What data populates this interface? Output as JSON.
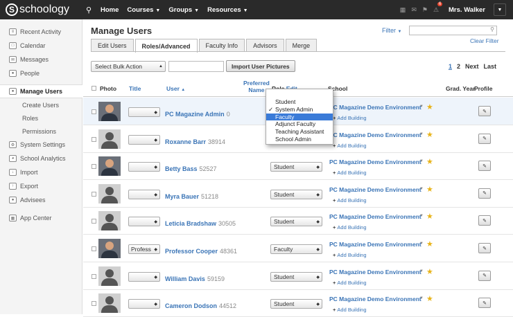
{
  "topbar": {
    "logo_mark": "S",
    "logo_text": "schoology",
    "nav": [
      "Home",
      "Courses",
      "Groups",
      "Resources"
    ],
    "notification_count": "6",
    "user_name": "Mrs. Walker"
  },
  "sidebar": {
    "items": [
      {
        "label": "Recent Activity",
        "icon": "activity-icon"
      },
      {
        "label": "Calendar",
        "icon": "calendar-icon"
      },
      {
        "label": "Messages",
        "icon": "envelope-icon"
      },
      {
        "label": "People",
        "icon": "people-icon"
      },
      {
        "label": "Manage Users",
        "icon": "users-icon"
      }
    ],
    "subitems": [
      "Create Users",
      "Roles",
      "Permissions"
    ],
    "items2": [
      {
        "label": "System Settings",
        "icon": "gear-icon"
      },
      {
        "label": "School Analytics",
        "icon": "analytics-icon"
      },
      {
        "label": "Import",
        "icon": "import-icon"
      },
      {
        "label": "Export",
        "icon": "export-icon"
      },
      {
        "label": "Advisees",
        "icon": "advisees-icon"
      }
    ],
    "app_center": "App Center"
  },
  "main": {
    "title": "Manage Users",
    "filter_label": "Filter",
    "clear_filter": "Clear Filter",
    "tabs": [
      "Edit Users",
      "Roles/Advanced",
      "Faculty Info",
      "Advisors",
      "Merge"
    ],
    "bulk_action": "Select Bulk Action",
    "import_button": "Import User Pictures",
    "pager": {
      "page1": "1",
      "page2": "2",
      "next": "Next",
      "last": "Last"
    }
  },
  "table": {
    "headers": {
      "photo": "Photo",
      "title": "Title",
      "user": "User",
      "preferred_line1": "Preferred",
      "preferred_line2": "Name",
      "role": "Role",
      "role_edit": "Edit",
      "school": "School",
      "grad_year": "Grad. Year",
      "profile": "Profile"
    },
    "add_building": "Add Building",
    "rows": [
      {
        "name": "PC Magazine Admin",
        "id": "0",
        "title": "",
        "role": "",
        "school": "PC Magazine Demo Environment"
      },
      {
        "name": "Roxanne Barr",
        "id": "38914",
        "title": "",
        "role": "",
        "school": "PC Magazine Demo Environment"
      },
      {
        "name": "Betty Bass",
        "id": "52527",
        "title": "",
        "role": "Student",
        "school": "PC Magazine Demo Environment"
      },
      {
        "name": "Myra Bauer",
        "id": "51218",
        "title": "",
        "role": "Student",
        "school": "PC Magazine Demo Environment"
      },
      {
        "name": "Leticia Bradshaw",
        "id": "30505",
        "title": "",
        "role": "Student",
        "school": "PC Magazine Demo Environment"
      },
      {
        "name": "Professor Cooper",
        "id": "48361",
        "title": "Profess",
        "role": "Faculty",
        "school": "PC Magazine Demo Environment"
      },
      {
        "name": "William Davis",
        "id": "59159",
        "title": "",
        "role": "Student",
        "school": "PC Magazine Demo Environment"
      },
      {
        "name": "Cameron Dodson",
        "id": "44512",
        "title": "",
        "role": "Student",
        "school": "PC Magazine Demo Environment"
      }
    ]
  },
  "role_dropdown": {
    "options": [
      "Student",
      "System Admin",
      "Faculty",
      "Adjunct Faculty",
      "Teaching Assistant",
      "School Admin"
    ],
    "checked": "System Admin",
    "highlighted": "Faculty"
  },
  "colors": {
    "topbar": "#2a2a2a",
    "link": "#3a74b6",
    "highlight": "#3a7bd8",
    "star": "#e8b319"
  }
}
